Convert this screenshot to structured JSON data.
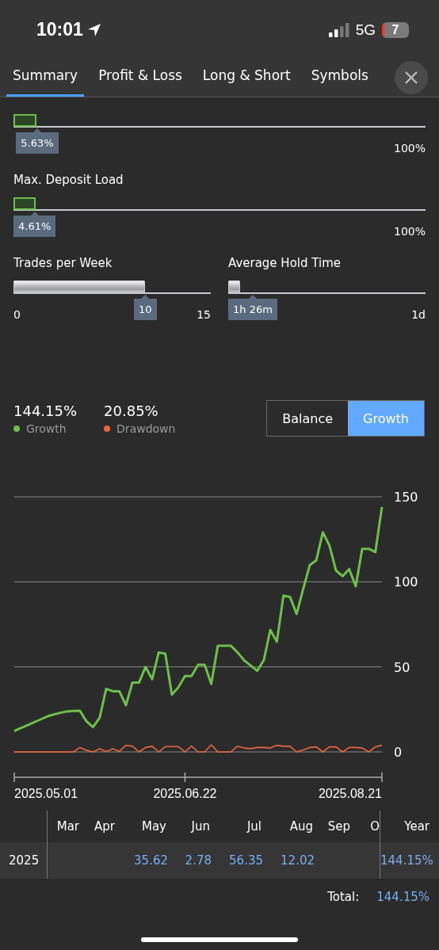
{
  "status_bar": {
    "time": "10:01",
    "network": "5G",
    "battery": "7"
  },
  "tabs": [
    {
      "label": "Summary",
      "selected": true
    },
    {
      "label": "Profit & Loss",
      "selected": false
    },
    {
      "label": "Long & Short",
      "selected": false
    },
    {
      "label": "Symbols",
      "selected": false
    }
  ],
  "sliders": [
    {
      "kind": "risk",
      "level": 0.0563,
      "value": "5.63%",
      "max": "100%"
    },
    {
      "label": "Max. Deposit Load",
      "kind": "risk",
      "level": 0.0461,
      "value": "4.61%",
      "max": "100%"
    },
    {
      "label": "Trades per Week",
      "kind": "count",
      "level": 0.667,
      "value": "10",
      "min": "0",
      "max": "15"
    },
    {
      "label": "Average Hold Time",
      "kind": "count",
      "level": 0.06,
      "value": "1h 26m",
      "max": "1d"
    }
  ],
  "stats": [
    {
      "value": "144.15%",
      "label": "Growth",
      "color": "#6cc04a"
    },
    {
      "value": "20.85%",
      "label": "Drawdown",
      "color": "#e8663d"
    }
  ],
  "toggle": [
    {
      "label": "Balance",
      "selected": false
    },
    {
      "label": "Growth",
      "selected": true
    }
  ],
  "chart": {
    "chart_data": {
      "type": "line",
      "categories": [
        null,
        null,
        null,
        null,
        null,
        "2025.05.01",
        null,
        null,
        null,
        null,
        null,
        null,
        null,
        null,
        null,
        null,
        null,
        null,
        null,
        null,
        null,
        null,
        null,
        null,
        null,
        null,
        "2025.06.22",
        null,
        null,
        null,
        null,
        null,
        null,
        null,
        null,
        null,
        null,
        null,
        null,
        null,
        null,
        null,
        null,
        null,
        null,
        null,
        null,
        null,
        null,
        null,
        null,
        "2025.08.21",
        null,
        null,
        null,
        null,
        null
      ],
      "series": [
        {
          "color": "#6cc04a",
          "values": [
            12.3,
            14,
            15.7,
            17.4,
            19.1,
            20.8,
            22,
            23,
            23.8,
            24.1,
            24.2,
            18,
            14.6,
            20,
            37.1,
            35.7,
            35.7,
            27.5,
            40.7,
            40.7,
            50,
            42.7,
            58.5,
            57.8,
            33.7,
            38,
            44.6,
            44.6,
            51.2,
            51.2,
            39.9,
            62.4,
            62.4,
            62.4,
            58.5,
            53.9,
            50.8,
            47.7,
            53.9,
            71.7,
            64.8,
            91.9,
            91.1,
            81.1,
            95.8,
            109.8,
            112.6,
            129.2,
            121.4,
            106.7,
            103.3,
            107.5,
            97.4,
            119.4,
            119.4,
            117.5,
            144
          ]
        },
        {
          "color": "#e8663d",
          "values": [
            0,
            0,
            0,
            0,
            0,
            0,
            0,
            0,
            0,
            0,
            2.6,
            1,
            0,
            1.9,
            0.3,
            1.9,
            0.3,
            3.9,
            3.4,
            0,
            2.6,
            3.3,
            0,
            3.1,
            3.1,
            3.1,
            0,
            3.4,
            0,
            0,
            4.2,
            0,
            0,
            0,
            3.4,
            2.3,
            1.9,
            2.6,
            2.6,
            2.3,
            3.9,
            3.3,
            3.3,
            0,
            1.1,
            2.6,
            3,
            0,
            3,
            3,
            0,
            2.6,
            2.6,
            2.3,
            0,
            3,
            3.9
          ]
        }
      ],
      "ylim": [
        0,
        150
      ],
      "yticks": [
        0,
        50,
        100,
        150
      ]
    }
  },
  "monthly": {
    "columns": [
      "Mar",
      "Apr",
      "May",
      "Jun",
      "Jul",
      "Aug",
      "Sep",
      "O",
      "Year"
    ],
    "rows": [
      {
        "year": "2025",
        "cells": [
          "",
          "",
          "35.62",
          "2.78",
          "56.35",
          "12.02",
          "",
          "",
          "144.15%"
        ]
      }
    ],
    "total_label": "Total:",
    "total": "144.15%"
  }
}
